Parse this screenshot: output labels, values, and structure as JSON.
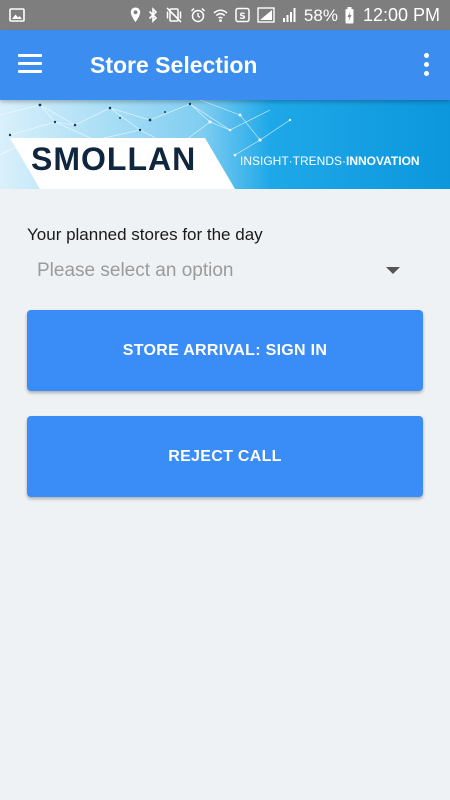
{
  "status_bar": {
    "battery_percent": "58%",
    "time": "12:00 PM",
    "left_icons": [
      "image-icon"
    ],
    "right_icons": [
      "location-icon",
      "bluetooth-icon",
      "vibrate-mute-icon",
      "alarm-icon",
      "wifi-icon",
      "data-saver-icon",
      "signal-box-icon",
      "cell-signal-icon",
      "battery-charging-icon"
    ]
  },
  "app_bar": {
    "title": "Store Selection",
    "left_icon": "menu-icon",
    "right_icon": "more-vertical-icon",
    "color": "#3b8eef"
  },
  "banner": {
    "brand": "SMOLLAN",
    "tagline_part1": "INSIGHT",
    "tagline_part2": "TRENDS",
    "tagline_part3": "INNOVATION",
    "tagline_sep": "·",
    "color": "#1aa5e6"
  },
  "form": {
    "label": "Your planned stores for the day",
    "select_placeholder": "Please select an option"
  },
  "buttons": {
    "arrival": "STORE ARRIVAL: SIGN IN",
    "reject": "REJECT CALL",
    "color": "#3a8cf7"
  }
}
